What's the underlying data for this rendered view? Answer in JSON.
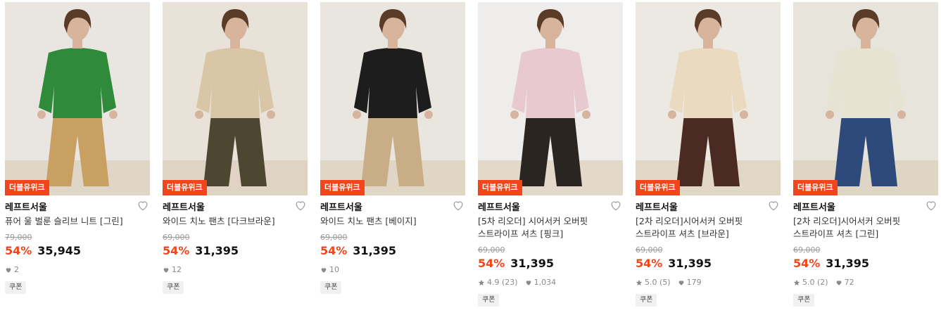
{
  "products": [
    {
      "badge": "더블유위크",
      "brand": "레프트서울",
      "name": "퓨어 울 벌룬 슬리브 니트 [그린]",
      "original_price": "79,000",
      "discount": "54%",
      "price": "35,945",
      "rating": "",
      "review_count": "",
      "likes": "2",
      "coupon": "쿠폰",
      "palette": {
        "bg": "#e9e6e2",
        "top": "#2f8a3a",
        "bottom": "#c7a062",
        "skin": "#d7b49b",
        "hair": "#5a3b28"
      }
    },
    {
      "badge": "더블유위크",
      "brand": "레프트서울",
      "name": "와이드 치노 팬츠 [다크브라운]",
      "original_price": "69,000",
      "discount": "54%",
      "price": "31,395",
      "rating": "",
      "review_count": "",
      "likes": "12",
      "coupon": "쿠폰",
      "palette": {
        "bg": "#e8e2d8",
        "top": "#d9c6a6",
        "bottom": "#4d4630",
        "skin": "#d7b49b",
        "hair": "#5a3b28"
      }
    },
    {
      "badge": "더블유위크",
      "brand": "레프트서울",
      "name": "와이드 치노 팬츠 [베이지]",
      "original_price": "69,000",
      "discount": "54%",
      "price": "31,395",
      "rating": "",
      "review_count": "",
      "likes": "10",
      "coupon": "쿠폰",
      "palette": {
        "bg": "#e9e5df",
        "top": "#1d1d1d",
        "bottom": "#c8ad86",
        "skin": "#d7b49b",
        "hair": "#5a3b28"
      }
    },
    {
      "badge": "더블유위크",
      "brand": "레프트서울",
      "name": "[5차 리오더] 시어서커 오버핏\n스트라이프 셔츠 [핑크]",
      "original_price": "69,000",
      "discount": "54%",
      "price": "31,395",
      "rating": "4.9",
      "review_count": "(23)",
      "likes": "1,034",
      "coupon": "쿠폰",
      "palette": {
        "bg": "#efedeb",
        "top": "#e8c9cf",
        "bottom": "#2b2521",
        "skin": "#d7b49b",
        "hair": "#5a3b28"
      }
    },
    {
      "badge": "더블유위크",
      "brand": "레프트서울",
      "name": "[2차 리오더]시어서커 오버핏\n스트라이프 셔츠 [브라운]",
      "original_price": "69,000",
      "discount": "54%",
      "price": "31,395",
      "rating": "5.0",
      "review_count": "(5)",
      "likes": "179",
      "coupon": "쿠폰",
      "palette": {
        "bg": "#ece8e2",
        "top": "#eadbc0",
        "bottom": "#4a2a22",
        "skin": "#d7b49b",
        "hair": "#5a3b28"
      }
    },
    {
      "badge": "더블유위크",
      "brand": "레프트서울",
      "name": "[2차 리오더]시어서커 오버핏\n스트라이프 셔츠 [그린]",
      "original_price": "69,000",
      "discount": "54%",
      "price": "31,395",
      "rating": "5.0",
      "review_count": "(2)",
      "likes": "72",
      "coupon": "쿠폰",
      "palette": {
        "bg": "#e7e4dc",
        "top": "#e6e3d2",
        "bottom": "#2d4a7a",
        "skin": "#d7b49b",
        "hair": "#5a3b28"
      }
    }
  ],
  "colors": {
    "accent": "#f2451c",
    "strike": "#9a9a9a"
  },
  "icons": {
    "wishlist": "heart-outline-icon",
    "likes": "heart-icon",
    "rating": "star-icon"
  }
}
